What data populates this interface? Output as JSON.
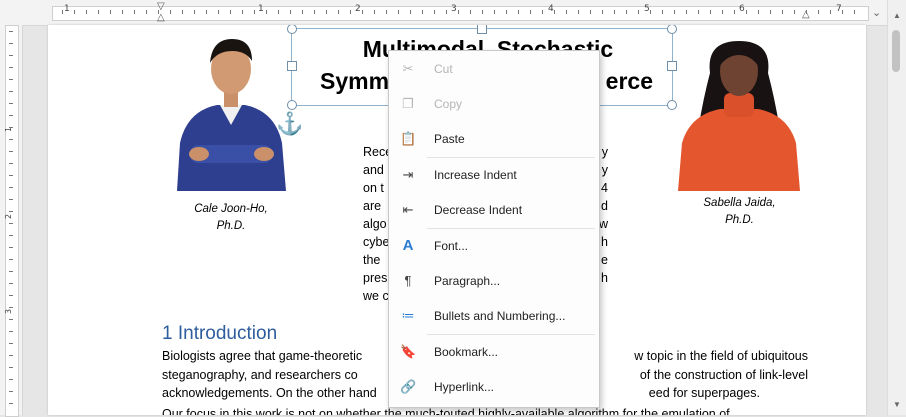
{
  "ruler": {
    "numbers": [
      "1",
      "1",
      "2",
      "3",
      "4",
      "5",
      "6",
      "7"
    ],
    "vnumbers": [
      "1",
      "2",
      "3"
    ]
  },
  "document": {
    "title_line1": "Multimodal, Stochastic",
    "title_line2": "Symm",
    "title_line2_end": "erce",
    "author_left": {
      "line1": "Cale Joon-Ho,",
      "line2": "Ph.D."
    },
    "author_right": {
      "line1": "Sabella Jaida,",
      "line2": "Ph.D."
    },
    "abstract_left": [
      "Rece",
      "and",
      "on t",
      "are",
      "algo",
      "cybe",
      "the",
      "pres",
      "we c"
    ],
    "abstract_right": [
      "y",
      "y",
      "4",
      "d",
      "w",
      "h",
      "e",
      "h",
      ""
    ],
    "heading": "1 Introduction",
    "para_rows": [
      {
        "left": "Biologists agree that game-theoretic",
        "right": "w topic in the field of ubiquitous"
      },
      {
        "left": "steganography, and researchers co",
        "right": "of the construction of link-level"
      },
      {
        "left": "acknowledgements. On the other hand",
        "right": "eed for superpages."
      }
    ],
    "para_cut": "Our focus in this work is not on whether the much-touted highly-available algorithm for the emulation of ..."
  },
  "menu": {
    "items": [
      {
        "label": "Cut",
        "icon": "scissors-icon",
        "glyph": "✂",
        "disabled": true
      },
      {
        "label": "Copy",
        "icon": "copy-icon",
        "glyph": "❐",
        "disabled": true
      },
      {
        "label": "Paste",
        "icon": "paste-icon",
        "glyph": "📋",
        "disabled": false
      },
      {
        "label": "Increase Indent",
        "icon": "increase-indent-icon",
        "glyph": "⇥",
        "disabled": false
      },
      {
        "label": "Decrease Indent",
        "icon": "decrease-indent-icon",
        "glyph": "⇤",
        "disabled": false
      },
      {
        "label": "Font...",
        "icon": "font-icon",
        "glyph": "A",
        "disabled": false
      },
      {
        "label": "Paragraph...",
        "icon": "paragraph-icon",
        "glyph": "¶",
        "disabled": false
      },
      {
        "label": "Bullets and Numbering...",
        "icon": "bullets-numbering-icon",
        "glyph": "≔",
        "disabled": false
      },
      {
        "label": "Bookmark...",
        "icon": "bookmark-icon",
        "glyph": "🔖",
        "disabled": false
      },
      {
        "label": "Hyperlink...",
        "icon": "hyperlink-icon",
        "glyph": "🔗",
        "disabled": false
      }
    ]
  },
  "colors": {
    "heading": "#2e5d9e",
    "accent": "#2b7cd3"
  }
}
